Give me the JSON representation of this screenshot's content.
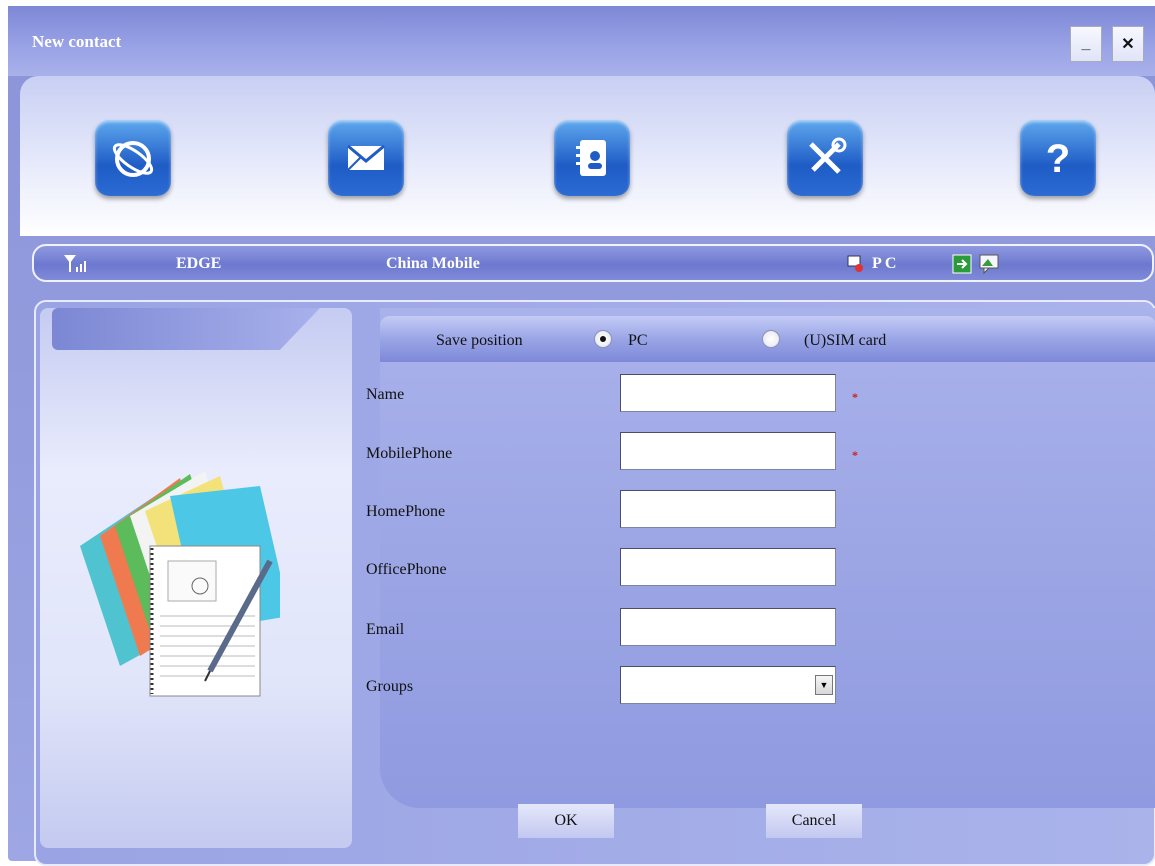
{
  "window": {
    "title": "New contact",
    "minimize_label": "_",
    "close_label": "✕"
  },
  "toolbar": {
    "items": [
      {
        "icon": "internet-icon"
      },
      {
        "icon": "message-icon"
      },
      {
        "icon": "contacts-icon"
      },
      {
        "icon": "tools-icon"
      },
      {
        "icon": "help-icon"
      }
    ]
  },
  "status": {
    "network": "EDGE",
    "operator": "China Mobile",
    "storage": "P C"
  },
  "form": {
    "save_position_label": "Save position",
    "options": [
      {
        "label": "PC",
        "selected": true
      },
      {
        "label": "(U)SIM card",
        "selected": false
      }
    ],
    "fields": [
      {
        "label": "Name",
        "value": "",
        "required": true
      },
      {
        "label": "MobilePhone",
        "value": "",
        "required": true
      },
      {
        "label": "HomePhone",
        "value": "",
        "required": false
      },
      {
        "label": "OfficePhone",
        "value": "",
        "required": false
      },
      {
        "label": "Email",
        "value": "",
        "required": false
      },
      {
        "label": "Groups",
        "value": "",
        "required": false
      }
    ],
    "required_mark": "*",
    "ok_label": "OK",
    "cancel_label": "Cancel"
  },
  "colors": {
    "accent": "#1f5cc6",
    "window_bg": "#9aa4e4",
    "required": "#cc2222"
  }
}
